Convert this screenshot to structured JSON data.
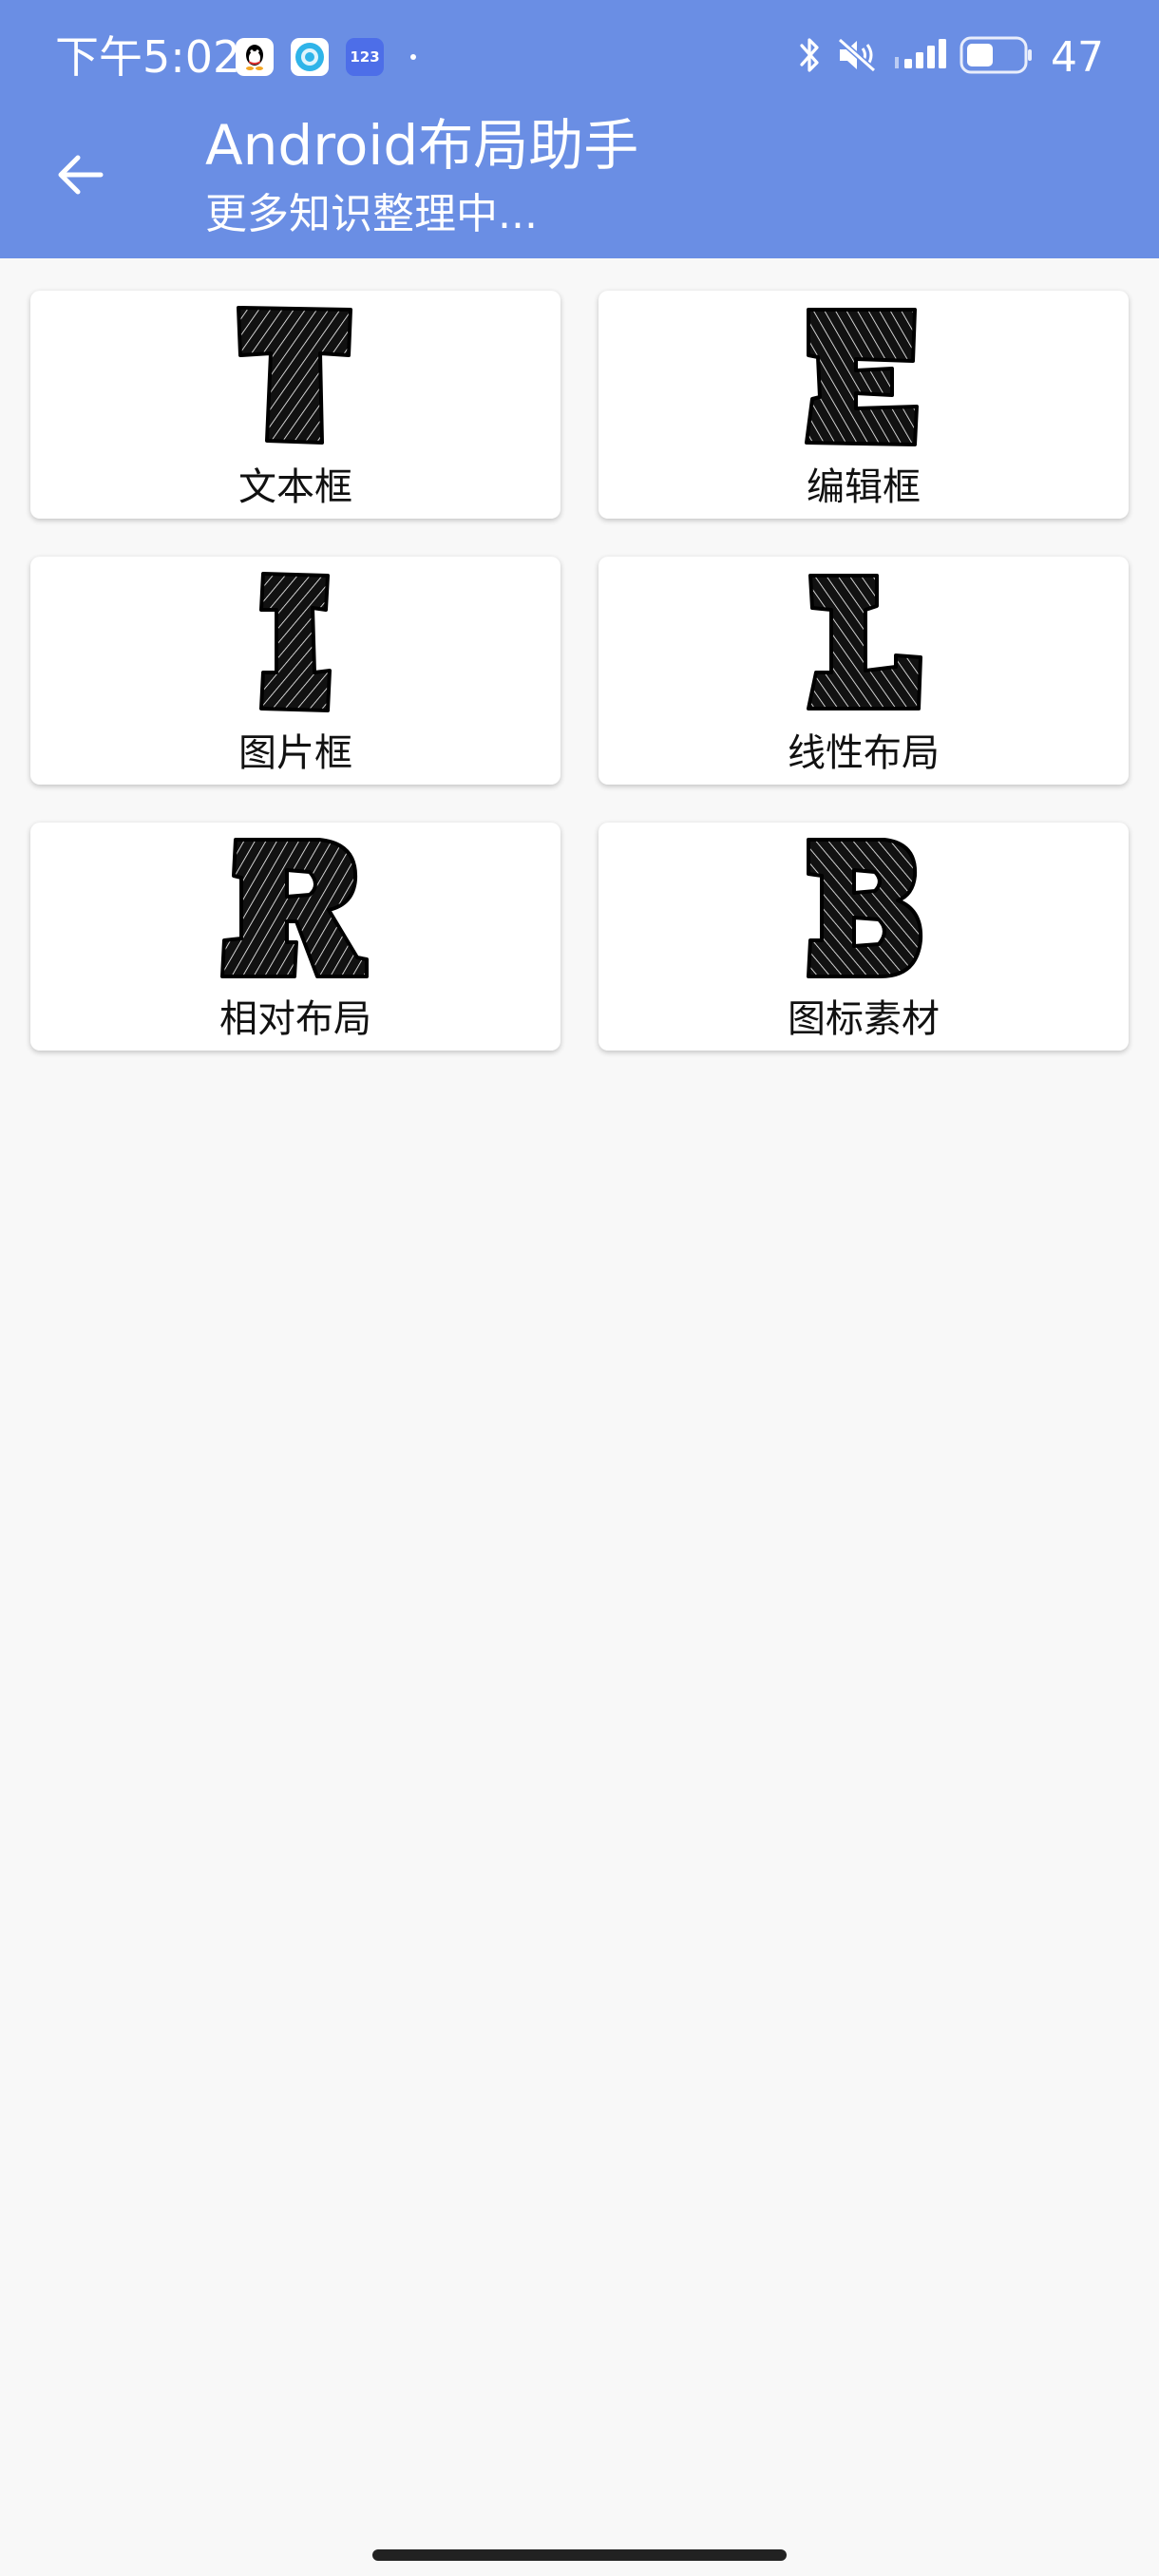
{
  "status_bar": {
    "time": "下午5:02",
    "notification_icons": [
      "qq-icon",
      "lx-app-icon",
      "app-123-icon"
    ],
    "icon_123_label": "123",
    "system_icons": [
      "bluetooth-icon",
      "mute-icon",
      "signal-icon",
      "battery-icon"
    ],
    "battery_level": "47"
  },
  "app_bar": {
    "background_color": "#6a8ee4",
    "back_icon": "arrow-back-icon",
    "title": "Android布局助手",
    "subtitle": "更多知识整理中..."
  },
  "cards": [
    {
      "letter": "T",
      "label": "文本框"
    },
    {
      "letter": "E",
      "label": "编辑框"
    },
    {
      "letter": "I",
      "label": "图片框"
    },
    {
      "letter": "L",
      "label": "线性布局"
    },
    {
      "letter": "R",
      "label": "相对布局"
    },
    {
      "letter": "B",
      "label": "图标素材"
    }
  ],
  "colors": {
    "page_background": "#f8f8f8",
    "card_background": "#ffffff",
    "text": "#111111"
  }
}
